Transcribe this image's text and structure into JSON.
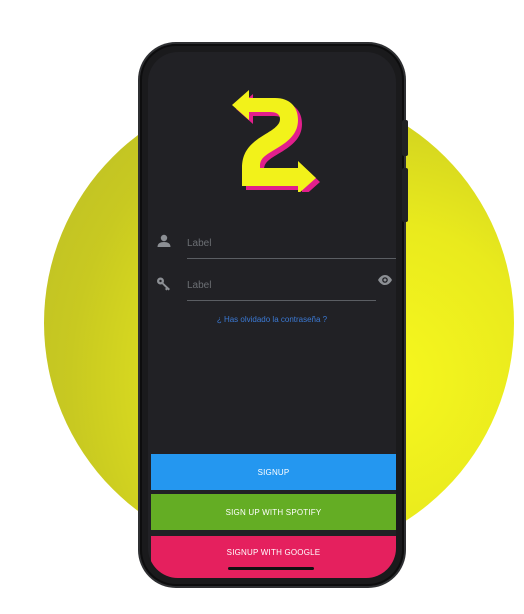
{
  "login": {
    "username_label": "Label",
    "password_label": "Label",
    "forgot_link": "¿ Has olvidado la contraseña ?"
  },
  "buttons": {
    "signup": "SIGNUP",
    "spotify": "SIGN UP WITH SPOTIFY",
    "google": "SIGNUP WITH GOOGLE"
  },
  "colors": {
    "accent_yellow": "#f2f21a",
    "signup_blue": "#2497f0",
    "spotify_green": "#64ad24",
    "google_pink": "#e5205e",
    "link_blue": "#3b79d4"
  },
  "icons": [
    "user-icon",
    "key-icon",
    "eye-icon",
    "app-logo-icon"
  ]
}
